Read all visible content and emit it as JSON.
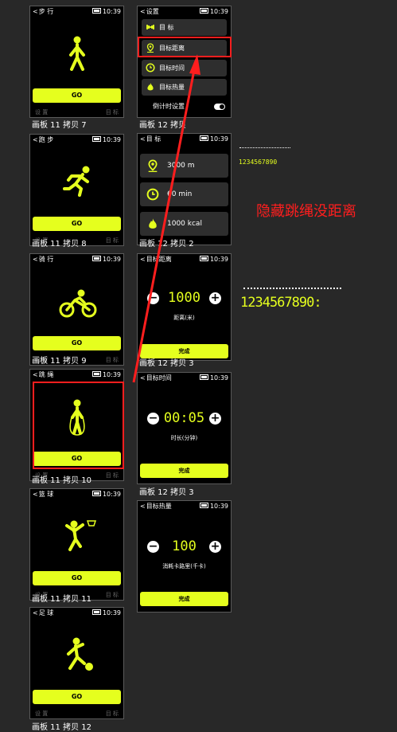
{
  "colors": {
    "accent": "#e5ff1e",
    "highlight": "#ff1e1e",
    "background": "#282828"
  },
  "clock": "10:39",
  "go_label": "GO",
  "footer": {
    "left": "设 置",
    "right": "目 标"
  },
  "sports": [
    {
      "title": "步 行",
      "caption": "画板 11 拷贝 7",
      "icon": "walk-icon"
    },
    {
      "title": "跑 步",
      "caption": "画板 11 拷贝 8",
      "icon": "run-icon"
    },
    {
      "title": "骑 行",
      "caption": "画板 11 拷贝 9",
      "icon": "bike-icon"
    },
    {
      "title": "跳 绳",
      "caption": "画板 11 拷贝 10",
      "icon": "jump-rope-icon"
    },
    {
      "title": "篮 球",
      "caption": "画板 11 拷贝 11",
      "icon": "basketball-icon"
    },
    {
      "title": "足 球",
      "caption": "画板 11 拷贝 12",
      "icon": "soccer-icon"
    }
  ],
  "settings": {
    "title": "设置",
    "caption": "画板 12 拷贝",
    "items": [
      {
        "label": "目 标",
        "icon": "dumbbell-icon"
      },
      {
        "label": "目标距离",
        "icon": "location-pin-icon"
      },
      {
        "label": "目标时间",
        "icon": "clock-icon"
      },
      {
        "label": "目标热量",
        "icon": "flame-icon"
      }
    ],
    "countdown_label": "倒计时设置"
  },
  "goals": {
    "title": "目 标",
    "caption": "画板 12 拷贝 2",
    "items": [
      {
        "value": "3000 m",
        "icon": "location-pin-icon"
      },
      {
        "value": "60 min",
        "icon": "clock-icon"
      },
      {
        "value": "1000 kcal",
        "icon": "flame-icon"
      }
    ]
  },
  "distance": {
    "title": "目标距离",
    "value": "1000",
    "unit": "距离(米)",
    "done": "完成",
    "caption": "画板 12 拷贝 3"
  },
  "time": {
    "title": "目标时间",
    "value": "00:05",
    "unit": "时长(分钟)",
    "done": "完成",
    "caption": "画板 12 拷贝 3"
  },
  "calories": {
    "title": "目标热量",
    "value": "100",
    "unit": "消耗卡路里(千卡)",
    "done": "完成"
  },
  "annotation": "隐藏跳绳没距离",
  "digits_small": "1234567890",
  "digits_large": "1234567890:"
}
